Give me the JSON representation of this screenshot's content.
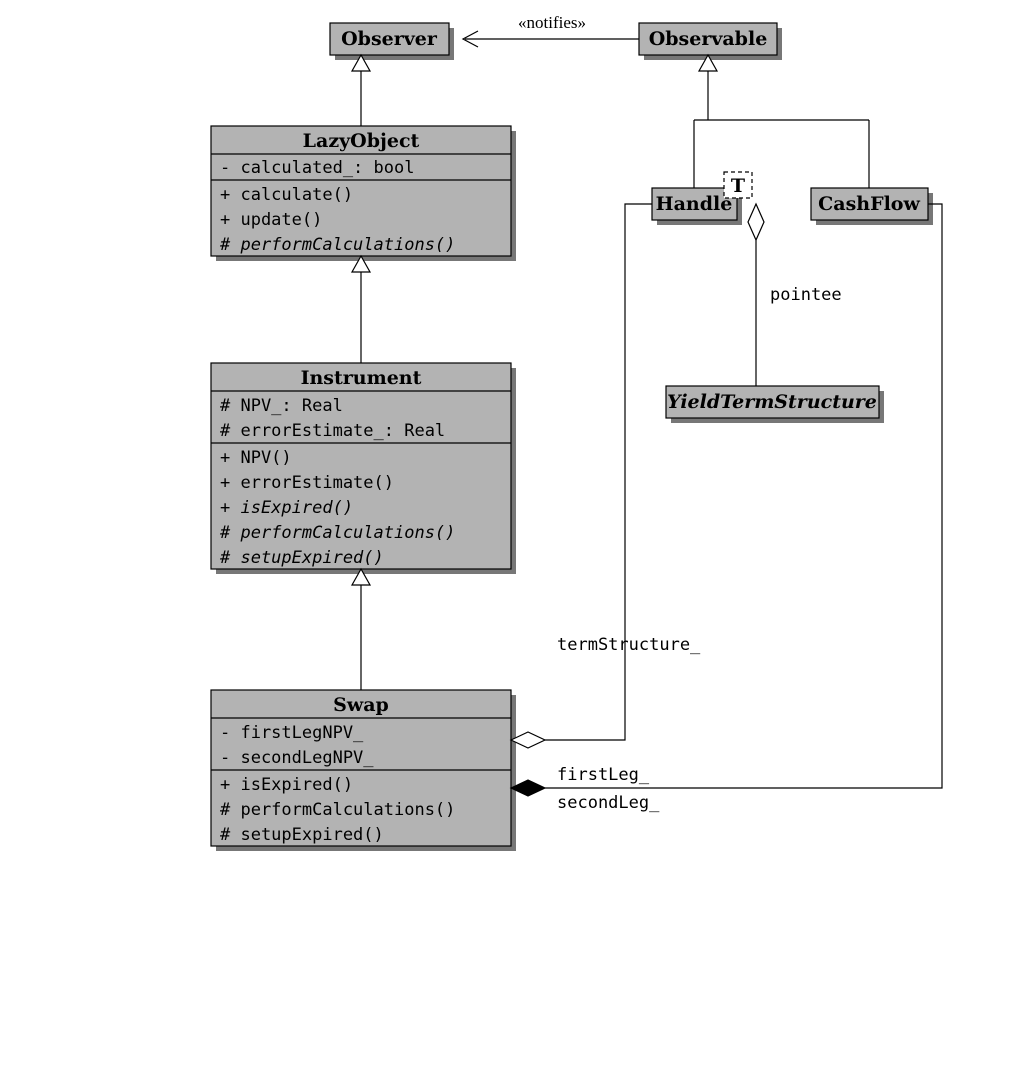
{
  "classes": {
    "observer": {
      "name": "Observer"
    },
    "observable": {
      "name": "Observable"
    },
    "lazyobject": {
      "name": "LazyObject",
      "attrs": [
        "- calculated_:  bool"
      ],
      "ops": [
        "+ calculate()",
        "+ update()",
        "# performCalculations()"
      ],
      "opStyles": [
        "mono",
        "mono",
        "mono-italic"
      ]
    },
    "instrument": {
      "name": "Instrument",
      "attrs": [
        "# NPV_:  Real",
        "# errorEstimate_:  Real"
      ],
      "ops": [
        "+ NPV()",
        "+ errorEstimate()",
        "+ isExpired()",
        "# performCalculations()",
        "# setupExpired()"
      ],
      "opStyles": [
        "mono",
        "mono",
        "mono-italic",
        "mono-italic",
        "mono-italic"
      ]
    },
    "swap": {
      "name": "Swap",
      "attrs": [
        "- firstLegNPV_",
        "- secondLegNPV_"
      ],
      "ops": [
        "+ isExpired()",
        "# performCalculations()",
        "# setupExpired()"
      ],
      "opStyles": [
        "mono",
        "mono",
        "mono"
      ]
    },
    "handle": {
      "name": "Handle",
      "templateParam": "T"
    },
    "cashflow": {
      "name": "CashFlow"
    },
    "yts": {
      "name": "YieldTermStructure"
    }
  },
  "labels": {
    "notifies": "«notifies»",
    "pointee": "pointee",
    "termStructure": "termStructure_",
    "firstLeg": "firstLeg_",
    "secondLeg": "secondLeg_"
  },
  "chart_data": {
    "type": "table",
    "description": "UML class diagram",
    "nodes": [
      {
        "id": "Observer",
        "stereotype": "class"
      },
      {
        "id": "Observable",
        "stereotype": "class"
      },
      {
        "id": "LazyObject",
        "stereotype": "class",
        "attributes": [
          "- calculated_: bool"
        ],
        "operations": [
          "+ calculate()",
          "+ update()",
          "# performCalculations() {abstract}"
        ]
      },
      {
        "id": "Instrument",
        "stereotype": "class",
        "attributes": [
          "# NPV_: Real",
          "# errorEstimate_: Real"
        ],
        "operations": [
          "+ NPV()",
          "+ errorEstimate()",
          "+ isExpired() {abstract}",
          "# performCalculations() {abstract}",
          "# setupExpired() {abstract}"
        ]
      },
      {
        "id": "Swap",
        "stereotype": "class",
        "attributes": [
          "- firstLegNPV_",
          "- secondLegNPV_"
        ],
        "operations": [
          "+ isExpired()",
          "# performCalculations()",
          "# setupExpired()"
        ]
      },
      {
        "id": "Handle",
        "stereotype": "class",
        "template": "T"
      },
      {
        "id": "CashFlow",
        "stereotype": "class"
      },
      {
        "id": "YieldTermStructure",
        "stereotype": "class"
      }
    ],
    "edges": [
      {
        "from": "Observable",
        "to": "Observer",
        "kind": "dependency",
        "label": "«notifies»"
      },
      {
        "from": "LazyObject",
        "to": "Observer",
        "kind": "generalization"
      },
      {
        "from": "Instrument",
        "to": "LazyObject",
        "kind": "generalization"
      },
      {
        "from": "Swap",
        "to": "Instrument",
        "kind": "generalization"
      },
      {
        "from": "Handle",
        "to": "Observable",
        "kind": "generalization"
      },
      {
        "from": "CashFlow",
        "to": "Observable",
        "kind": "generalization"
      },
      {
        "from": "Handle",
        "to": "YieldTermStructure",
        "kind": "aggregation",
        "label": "pointee"
      },
      {
        "from": "Swap",
        "to": "Handle",
        "kind": "aggregation",
        "label": "termStructure_"
      },
      {
        "from": "Swap",
        "to": "CashFlow",
        "kind": "composition",
        "label": "firstLeg_ / secondLeg_"
      }
    ]
  }
}
